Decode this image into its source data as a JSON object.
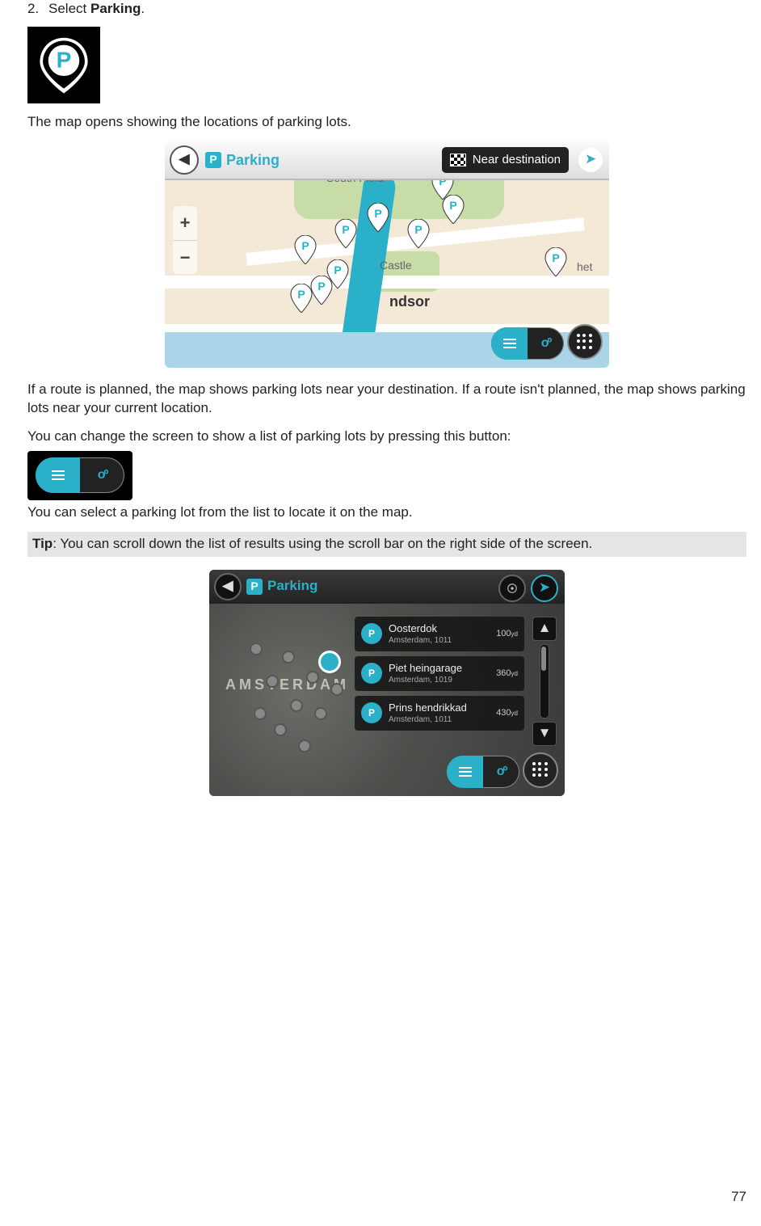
{
  "step": {
    "number": "2.",
    "prefix": "Select ",
    "bold": "Parking",
    "suffix": "."
  },
  "para1": "The map opens showing the locations of parking lots.",
  "map1": {
    "label": "Parking",
    "near_destination": "Near destination",
    "city": "ndsor",
    "south_field": "South Field",
    "castle": "Castle",
    "het": "het",
    "zoom_plus": "+",
    "zoom_minus": "−"
  },
  "para2": "If a route is planned, the map shows parking lots near your destination. If a route isn't planned, the map shows parking lots near your current location.",
  "para3": "You can change the screen to show a list of parking lots by pressing this button:",
  "para4": "You can select a parking lot from the list to locate it on the map.",
  "tip_label": "Tip",
  "tip_text": ": You can scroll down the list of results using the scroll bar on the right side of the screen.",
  "map2": {
    "label": "Parking",
    "city": "AMSTERDAM",
    "results": [
      {
        "title": "Oosterdok",
        "sub": "Amsterdam, 1011",
        "dist": "100",
        "unit": "yd"
      },
      {
        "title": "Piet heingarage",
        "sub": "Amsterdam, 1019",
        "dist": "360",
        "unit": "yd"
      },
      {
        "title": "Prins hendrikkad",
        "sub": "Amsterdam, 1011",
        "dist": "430",
        "unit": "yd"
      }
    ]
  },
  "page_number": "77"
}
